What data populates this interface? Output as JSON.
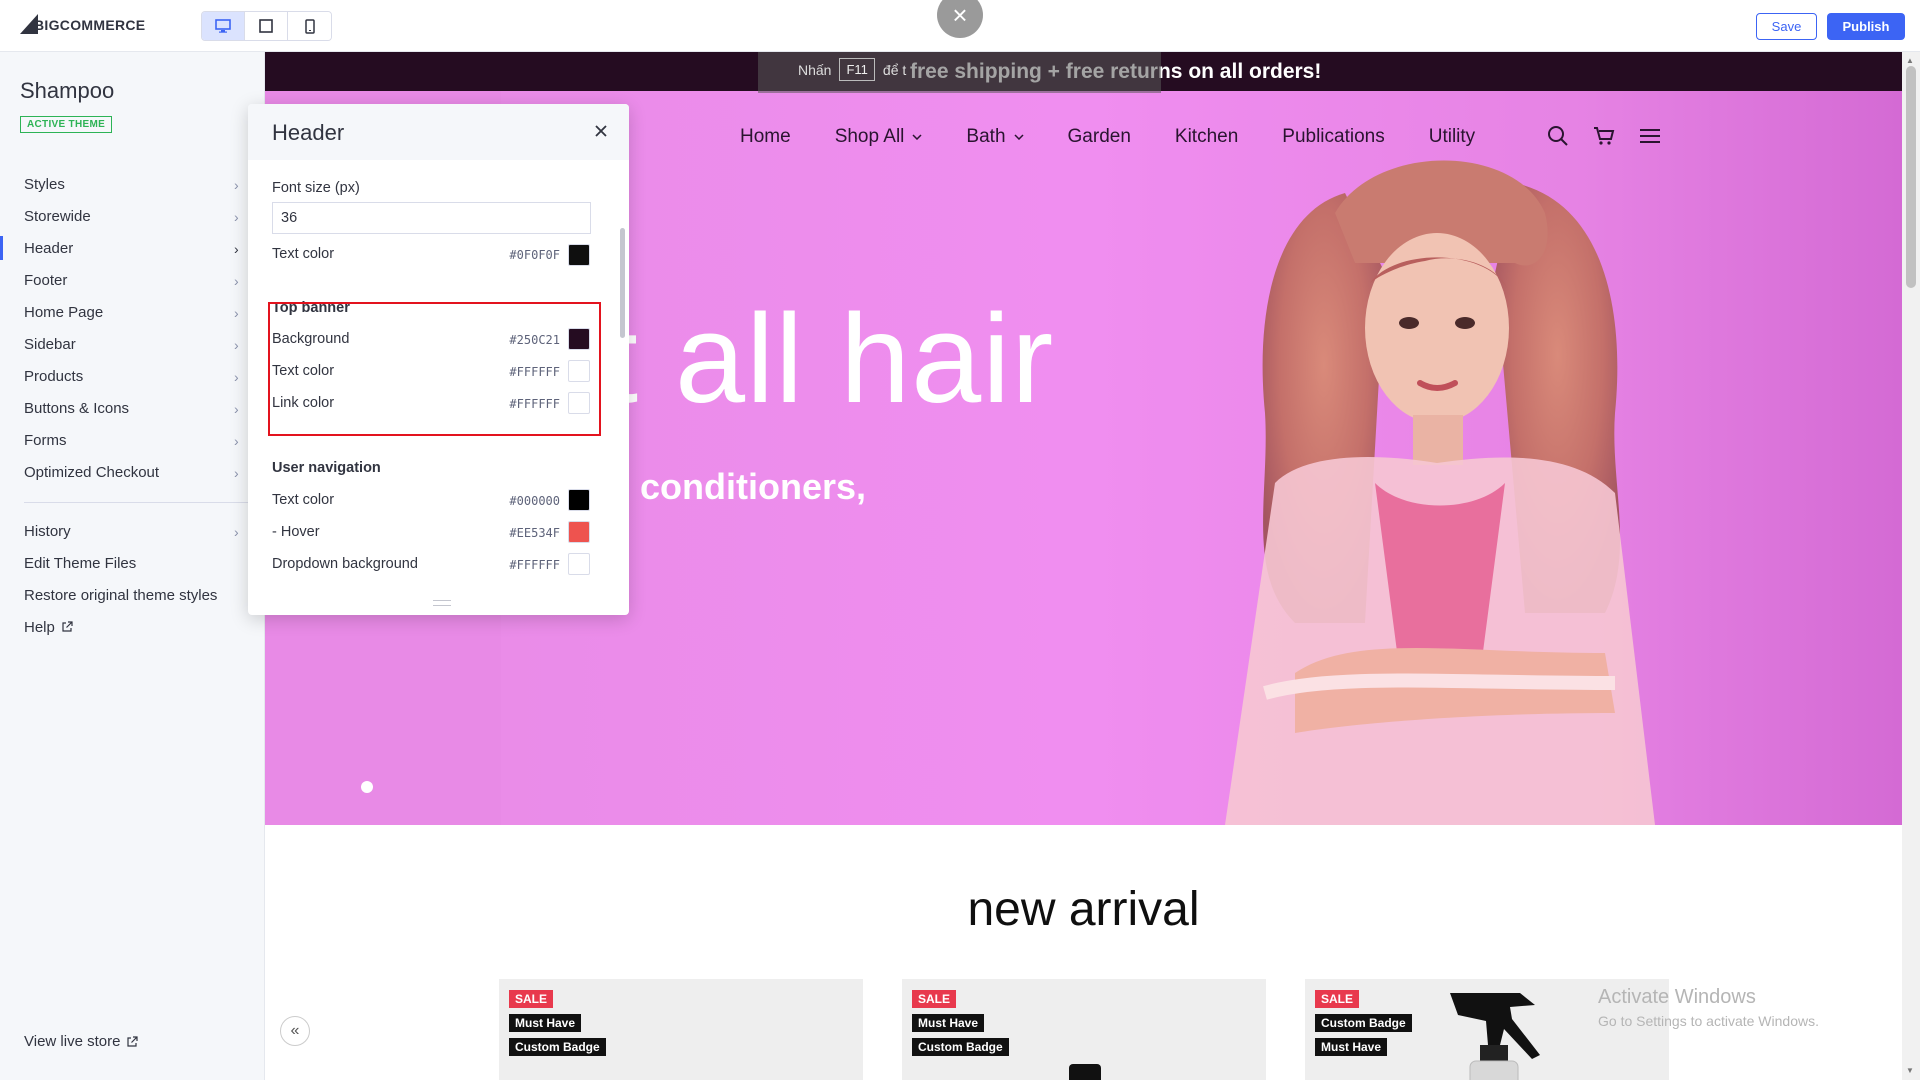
{
  "toolbar": {
    "logo_text_big": "BIG",
    "logo_text_rest": "COMMERCE",
    "devices": [
      "desktop",
      "tablet",
      "mobile"
    ],
    "close_glyph": "×",
    "save_label": "Save",
    "publish_label": "Publish",
    "colors": {
      "primary": "#3C64F4"
    }
  },
  "sidebar": {
    "theme_name": "Shampoo",
    "active_badge": "ACTIVE THEME",
    "items": [
      {
        "label": "Styles"
      },
      {
        "label": "Storewide"
      },
      {
        "label": "Header",
        "active": true
      },
      {
        "label": "Footer"
      },
      {
        "label": "Home Page"
      },
      {
        "label": "Sidebar"
      },
      {
        "label": "Products"
      },
      {
        "label": "Buttons & Icons"
      },
      {
        "label": "Forms"
      },
      {
        "label": "Optimized Checkout"
      }
    ],
    "secondary": [
      {
        "label": "History",
        "has_chevron": true
      },
      {
        "label": "Edit Theme Files"
      },
      {
        "label": "Restore original theme styles"
      },
      {
        "label": "Help",
        "external": true
      }
    ],
    "view_live_store": "View live store"
  },
  "panel": {
    "title": "Header",
    "font_size_label": "Font size (px)",
    "font_size_value": "36",
    "text_color_label": "Text color",
    "text_color_hex": "#0F0F0F",
    "top_banner": {
      "title": "Top banner",
      "background_label": "Background",
      "background_hex": "#250C21",
      "text_color_label": "Text color",
      "text_color_hex": "#FFFFFF",
      "link_color_label": "Link color",
      "link_color_hex": "#FFFFFF"
    },
    "user_navigation": {
      "title": "User navigation",
      "text_color_label": "Text color",
      "text_color_hex": "#000000",
      "hover_label": "- Hover",
      "hover_hex": "#EE534F",
      "dropdown_label": "Dropdown background",
      "dropdown_hex": "#FFFFFF"
    }
  },
  "preview": {
    "banner_text": "free shipping + free returns on all orders!",
    "fullscreen_hint_prefix": "Nhấn",
    "fullscreen_hint_key": "F11",
    "fullscreen_hint_suffix": "để t",
    "nav": [
      {
        "label": "Home"
      },
      {
        "label": "Shop All",
        "dropdown": true
      },
      {
        "label": "Bath",
        "dropdown": true
      },
      {
        "label": "Garden"
      },
      {
        "label": "Kitchen"
      },
      {
        "label": "Publications"
      },
      {
        "label": "Utility"
      }
    ],
    "nav_icons": [
      "search-icon",
      "cart-icon",
      "menu-icon"
    ],
    "hero_title": "t all hair",
    "hero_subtitle": "conditioners,",
    "section_title": "new arrival",
    "products": [
      {
        "badges": [
          "SALE",
          "Must Have",
          "Custom Badge"
        ]
      },
      {
        "badges": [
          "SALE",
          "Must Have",
          "Custom Badge"
        ]
      },
      {
        "badges": [
          "SALE",
          "Custom Badge",
          "Must Have"
        ]
      }
    ],
    "carousel_prev": "«",
    "activate_title": "Activate Windows",
    "activate_sub": "Go to Settings to activate Windows."
  }
}
